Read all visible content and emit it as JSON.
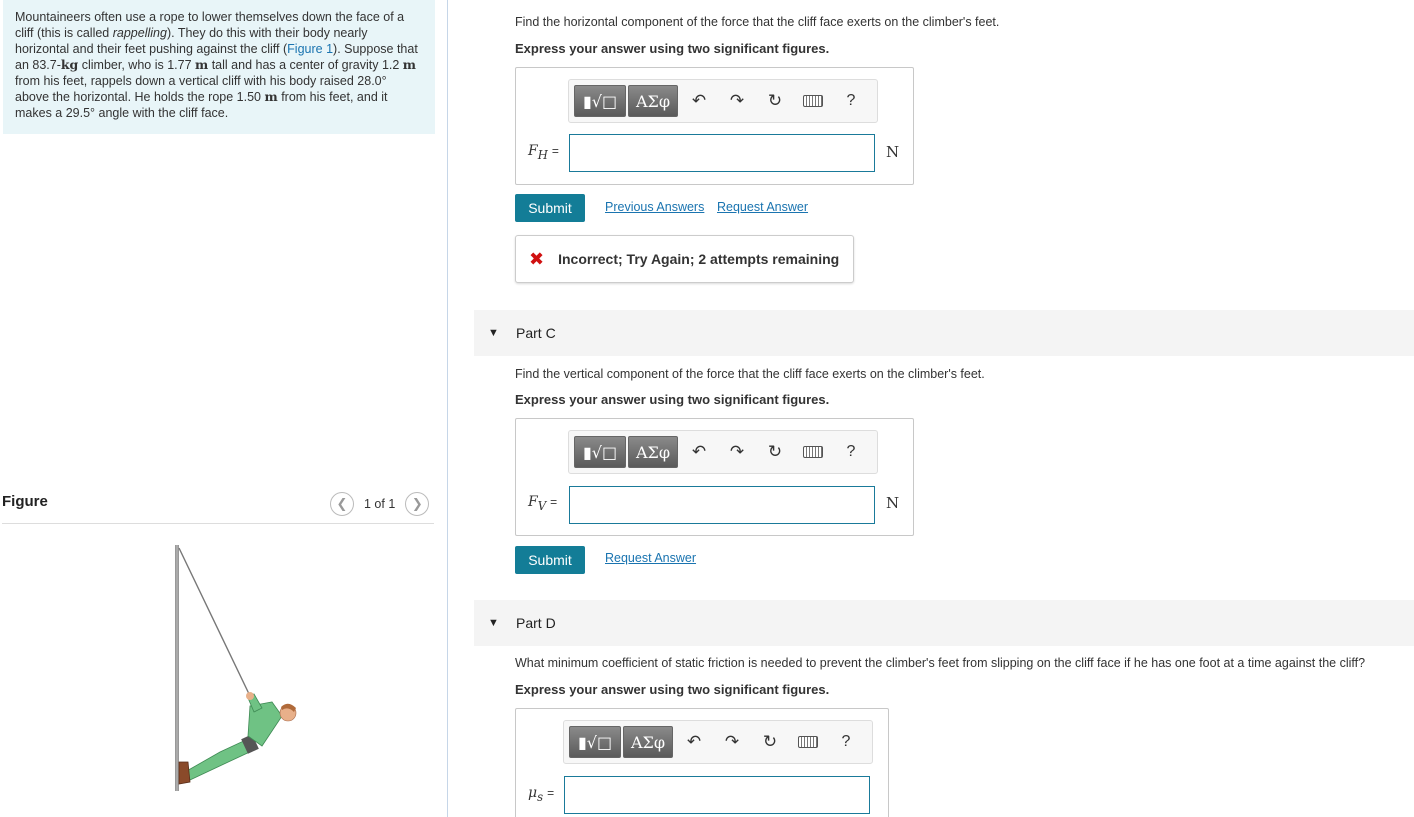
{
  "problem": {
    "t1": "Mountaineers often use a rope to lower themselves down the face of a cliff (this is called ",
    "t1_italic": "rappelling",
    "t2": "). They do this with their body nearly horizontal and their feet pushing against the cliff (",
    "figure_link": "Figure 1",
    "t3": "). Suppose that an 83.7-",
    "u_kg": "kg",
    "t4": " climber, who is 1.77 ",
    "u_m1": "m",
    "t5": " tall and has a center of gravity 1.2 ",
    "u_m2": "m",
    "t6": " from his feet, rappels down a vertical cliff with his body raised 28.0° above the horizontal. He holds the rope 1.50 ",
    "u_m3": "m",
    "t7": " from his feet, and it makes a 29.5° angle with the cliff face."
  },
  "figure_panel": {
    "title": "Figure",
    "counter": "1 of 1",
    "prev_icon": "chevron-left-icon",
    "next_icon": "chevron-right-icon"
  },
  "toolbar": {
    "template_label": "▮√□",
    "greek_label": "ΑΣφ",
    "undo": "↶",
    "redo": "↷",
    "reset": "↻",
    "help": "?"
  },
  "partB": {
    "question": "Find the horizontal component of the force that the cliff face exerts on the climber's feet.",
    "instruction": "Express your answer using two significant figures.",
    "var_main": "F",
    "var_sub": "H",
    "equals": "=",
    "unit": "N",
    "submit": "Submit",
    "previous_answers": "Previous Answers",
    "request_answer": "Request Answer",
    "feedback_icon": "✖",
    "feedback": "Incorrect; Try Again; 2 attempts remaining"
  },
  "partC": {
    "header": "Part C",
    "question": "Find the vertical component of the force that the cliff face exerts on the climber's feet.",
    "instruction": "Express your answer using two significant figures.",
    "var_main": "F",
    "var_sub": "V",
    "equals": "=",
    "unit": "N",
    "submit": "Submit",
    "request_answer": "Request Answer"
  },
  "partD": {
    "header": "Part D",
    "question": "What minimum coefficient of static friction is needed to prevent the climber's feet from slipping on the cliff face if he has one foot at a time against the cliff?",
    "instruction": "Express your answer using two significant figures.",
    "var_main": "μ",
    "var_sub": "s",
    "equals": "="
  },
  "colors": {
    "problem_bg": "#e8f5f8",
    "submit_bg": "#137d97",
    "link": "#1a74b0",
    "error": "#d01010"
  }
}
